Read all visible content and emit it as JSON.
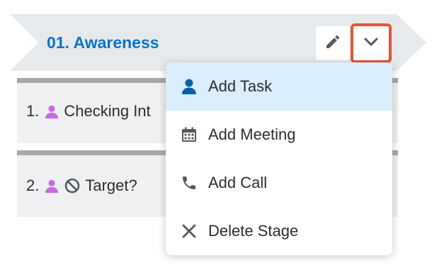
{
  "stage": {
    "title": "01. Awareness"
  },
  "tasks": [
    {
      "number": "1.",
      "title": "Checking Int",
      "icon": "person-icon"
    },
    {
      "number": "2.",
      "title": "Target?",
      "icon": "person-icon",
      "status_icon": "blocked-icon"
    }
  ],
  "menu": {
    "items": [
      {
        "label": "Add Task",
        "icon": "person-icon"
      },
      {
        "label": "Add Meeting",
        "icon": "calendar-icon"
      },
      {
        "label": "Add Call",
        "icon": "phone-icon"
      },
      {
        "label": "Delete Stage",
        "icon": "close-icon"
      }
    ]
  },
  "colors": {
    "accent": "#0b72c6",
    "highlight": "#e5543b",
    "menu_active": "#dbeefb",
    "person_icon": "#c56be3"
  }
}
